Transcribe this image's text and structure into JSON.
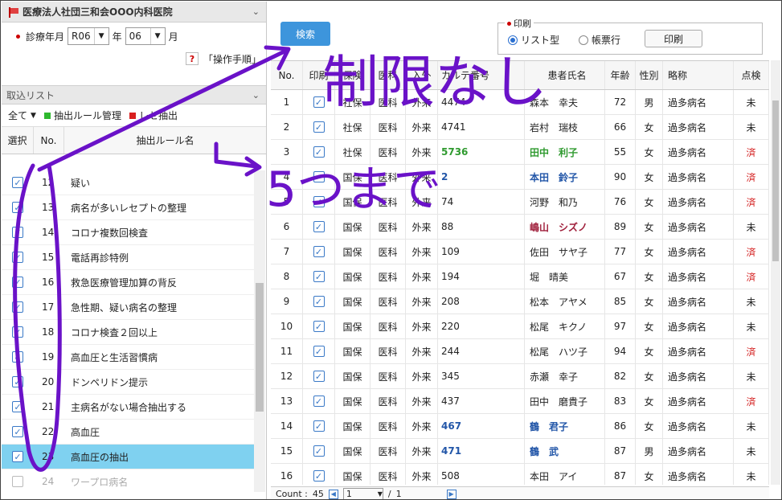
{
  "clinic": {
    "name": "医療法人社団三和会OOO内科医院"
  },
  "month": {
    "label": "診療年月",
    "era": "R06",
    "year_unit": "年",
    "month": "06",
    "month_unit": "月"
  },
  "help": {
    "q": "?",
    "label": "「操作手順」"
  },
  "import_list": {
    "title": "取込リスト"
  },
  "toolbar": {
    "all": "全て",
    "rule_manage": "抽出ルール管理",
    "rece": "レセ抽出"
  },
  "rule_table": {
    "headers": [
      "選択",
      "No.",
      "抽出ルール名"
    ],
    "rows": [
      {
        "no": "12",
        "name": "疑い",
        "checked": true
      },
      {
        "no": "13",
        "name": "病名が多いレセプトの整理",
        "checked": true
      },
      {
        "no": "14",
        "name": "コロナ複数回検査",
        "checked": true
      },
      {
        "no": "15",
        "name": "電話再診特例",
        "checked": true
      },
      {
        "no": "16",
        "name": "救急医療管理加算の背反",
        "checked": true
      },
      {
        "no": "17",
        "name": "急性期、疑い病名の整理",
        "checked": true
      },
      {
        "no": "18",
        "name": "コロナ検査２回以上",
        "checked": true
      },
      {
        "no": "19",
        "name": "高血圧と生活習慣病",
        "checked": true
      },
      {
        "no": "20",
        "name": "ドンペリドン提示",
        "checked": true
      },
      {
        "no": "21",
        "name": "主病名がない場合抽出する",
        "checked": true
      },
      {
        "no": "22",
        "name": "高血圧",
        "checked": true
      },
      {
        "no": "23",
        "name": "高血圧の抽出",
        "checked": true
      },
      {
        "no": "24",
        "name": "ワープロ病名",
        "checked": false
      }
    ]
  },
  "search": {
    "label": "検索"
  },
  "print": {
    "legend": "印刷",
    "opt1": "リスト型",
    "opt2": "帳票行",
    "button": "印刷"
  },
  "grid": {
    "headers": [
      "No.",
      "印刷",
      "保険",
      "医科",
      "入外",
      "カルテ番号",
      "患者氏名",
      "年齢",
      "性別",
      "略称",
      "点検"
    ],
    "rows": [
      {
        "no": "1",
        "ins": "社保",
        "sec": "医科",
        "io": "外来",
        "kid": "4474",
        "pt": "森本　幸夫",
        "age": "72",
        "sex": "男",
        "ab": "過多病名",
        "ck": "未"
      },
      {
        "no": "2",
        "ins": "社保",
        "sec": "医科",
        "io": "外来",
        "kid": "4741",
        "pt": "岩村　瑞枝",
        "age": "66",
        "sex": "女",
        "ab": "過多病名",
        "ck": "未"
      },
      {
        "no": "3",
        "ins": "社保",
        "sec": "医科",
        "io": "外来",
        "kid": "5736",
        "pt": "田中　利子",
        "age": "55",
        "sex": "女",
        "ab": "過多病名",
        "ck": "済"
      },
      {
        "no": "4",
        "ins": "国保",
        "sec": "医科",
        "io": "外来",
        "kid": "2",
        "pt": "本田　鈴子",
        "age": "90",
        "sex": "女",
        "ab": "過多病名",
        "ck": "済"
      },
      {
        "no": "5",
        "ins": "国保",
        "sec": "医科",
        "io": "外来",
        "kid": "74",
        "pt": "河野　和乃",
        "age": "76",
        "sex": "女",
        "ab": "過多病名",
        "ck": "済"
      },
      {
        "no": "6",
        "ins": "国保",
        "sec": "医科",
        "io": "外来",
        "kid": "88",
        "pt": "嶋山　シズノ",
        "age": "89",
        "sex": "女",
        "ab": "過多病名",
        "ck": "未"
      },
      {
        "no": "7",
        "ins": "国保",
        "sec": "医科",
        "io": "外来",
        "kid": "109",
        "pt": "佐田　サヤ子",
        "age": "77",
        "sex": "女",
        "ab": "過多病名",
        "ck": "済"
      },
      {
        "no": "8",
        "ins": "国保",
        "sec": "医科",
        "io": "外来",
        "kid": "194",
        "pt": "堀　晴美",
        "age": "67",
        "sex": "女",
        "ab": "過多病名",
        "ck": "済"
      },
      {
        "no": "9",
        "ins": "国保",
        "sec": "医科",
        "io": "外来",
        "kid": "208",
        "pt": "松本　アヤメ",
        "age": "85",
        "sex": "女",
        "ab": "過多病名",
        "ck": "未"
      },
      {
        "no": "10",
        "ins": "国保",
        "sec": "医科",
        "io": "外来",
        "kid": "220",
        "pt": "松尾　キクノ",
        "age": "97",
        "sex": "女",
        "ab": "過多病名",
        "ck": "未"
      },
      {
        "no": "11",
        "ins": "国保",
        "sec": "医科",
        "io": "外来",
        "kid": "244",
        "pt": "松尾　ハツ子",
        "age": "94",
        "sex": "女",
        "ab": "過多病名",
        "ck": "済"
      },
      {
        "no": "12",
        "ins": "国保",
        "sec": "医科",
        "io": "外来",
        "kid": "345",
        "pt": "赤瀬　幸子",
        "age": "82",
        "sex": "女",
        "ab": "過多病名",
        "ck": "未"
      },
      {
        "no": "13",
        "ins": "国保",
        "sec": "医科",
        "io": "外来",
        "kid": "437",
        "pt": "田中　磨貴子",
        "age": "83",
        "sex": "女",
        "ab": "過多病名",
        "ck": "済"
      },
      {
        "no": "14",
        "ins": "国保",
        "sec": "医科",
        "io": "外来",
        "kid": "467",
        "pt": "鶴　君子",
        "age": "86",
        "sex": "女",
        "ab": "過多病名",
        "ck": "未"
      },
      {
        "no": "15",
        "ins": "国保",
        "sec": "医科",
        "io": "外来",
        "kid": "471",
        "pt": "鶴　武",
        "age": "87",
        "sex": "男",
        "ab": "過多病名",
        "ck": "未"
      },
      {
        "no": "16",
        "ins": "国保",
        "sec": "医科",
        "io": "外来",
        "kid": "508",
        "pt": "本田　アイ",
        "age": "87",
        "sex": "女",
        "ab": "過多病名",
        "ck": "未"
      }
    ]
  },
  "footer": {
    "count_label": "Count :",
    "count": "45",
    "page": "1",
    "of": "/",
    "total_pages": "1"
  },
  "annotations": {
    "text1": "制限なし",
    "text2": "5つまで",
    "color": "#6a12c8"
  }
}
